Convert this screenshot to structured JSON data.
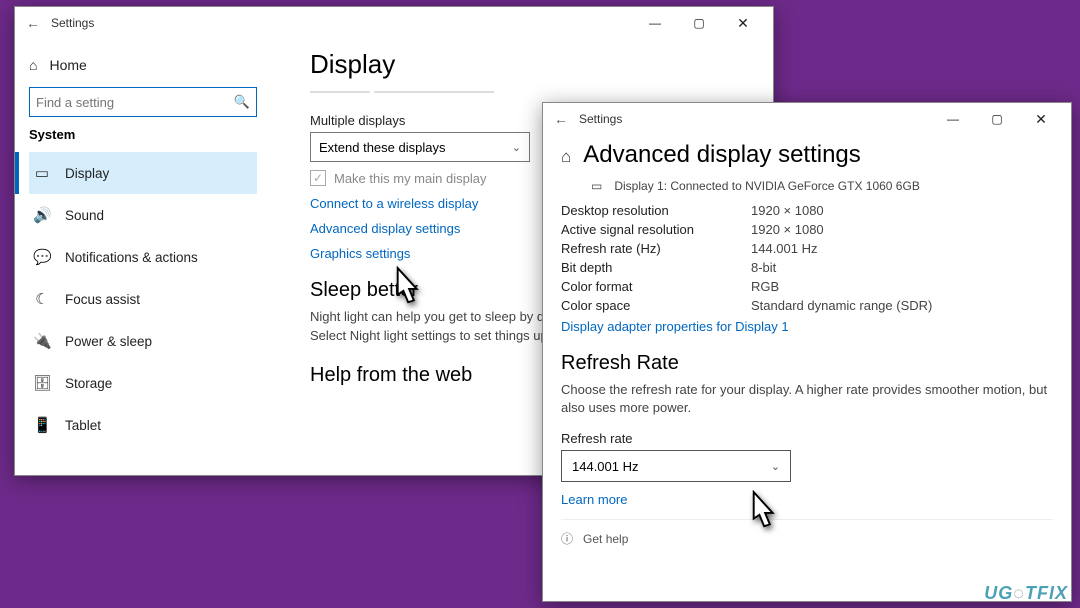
{
  "window1": {
    "title": "Settings",
    "home": "Home",
    "search_placeholder": "Find a setting",
    "section": "System",
    "nav": [
      {
        "icon": "▭",
        "label": "Display"
      },
      {
        "icon": "🔊",
        "label": "Sound"
      },
      {
        "icon": "💬",
        "label": "Notifications & actions"
      },
      {
        "icon": "☾",
        "label": "Focus assist"
      },
      {
        "icon": "🔌",
        "label": "Power & sleep"
      },
      {
        "icon": "🗄",
        "label": "Storage"
      },
      {
        "icon": "📱",
        "label": "Tablet"
      }
    ],
    "main": {
      "title": "Display",
      "cutoff": "————  ————————",
      "multi_label": "Multiple displays",
      "multi_value": "Extend these displays",
      "main_display_chk": "Make this my main display",
      "links": {
        "wireless": "Connect to a wireless display",
        "advanced": "Advanced display settings",
        "graphics": "Graphics settings"
      },
      "sleep_heading": "Sleep better",
      "sleep_text": "Night light can help you get to sleep by displaying warmer colors at night. Select Night light settings to set things up.",
      "help_heading": "Help from the web"
    }
  },
  "window2": {
    "title": "Settings",
    "heading": "Advanced display settings",
    "connected": "Display 1: Connected to NVIDIA GeForce GTX 1060 6GB",
    "kv": {
      "desktop_res_k": "Desktop resolution",
      "desktop_res_v": "1920 × 1080",
      "active_res_k": "Active signal resolution",
      "active_res_v": "1920 × 1080",
      "refresh_k": "Refresh rate (Hz)",
      "refresh_v": "144.001 Hz",
      "bitdepth_k": "Bit depth",
      "bitdepth_v": "8-bit",
      "colorfmt_k": "Color format",
      "colorfmt_v": "RGB",
      "colorspc_k": "Color space",
      "colorspc_v": "Standard dynamic range (SDR)"
    },
    "adapter_link": "Display adapter properties for Display 1",
    "rr_heading": "Refresh Rate",
    "rr_desc": "Choose the refresh rate for your display. A higher rate provides smoother motion, but also uses more power.",
    "rr_label": "Refresh rate",
    "rr_value": "144.001 Hz",
    "learn_more": "Learn more",
    "get_help": "Get help"
  },
  "watermark": "UG   TFIX"
}
